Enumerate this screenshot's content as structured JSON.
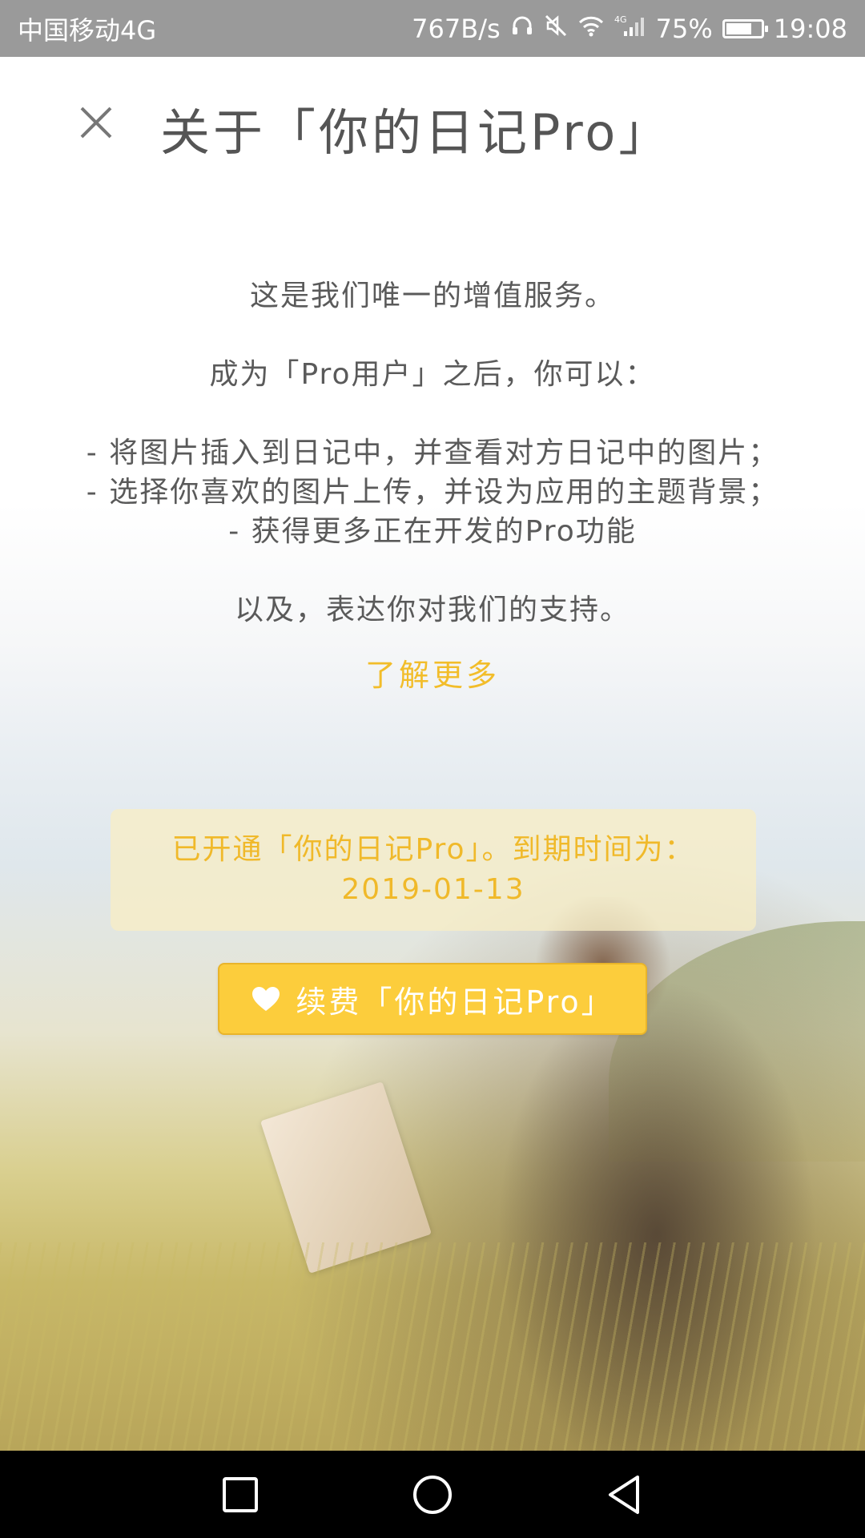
{
  "status_bar": {
    "carrier": "中国移动4G",
    "network_speed": "767B/s",
    "signal_type": "4G",
    "battery_percent": "75%",
    "battery_level": 0.75,
    "time": "19:08"
  },
  "header": {
    "title": "关于「你的日记Pro」",
    "close_icon": "close-icon"
  },
  "description": {
    "line1": "这是我们唯一的增值服务。",
    "line2": "成为「Pro用户」之后，你可以：",
    "features": [
      "- 将图片插入到日记中，并查看对方日记中的图片；",
      "- 选择你喜欢的图片上传，并设为应用的主题背景；",
      "- 获得更多正在开发的Pro功能"
    ],
    "line3": "以及，表达你对我们的支持。"
  },
  "learn_more": {
    "label": "了解更多"
  },
  "pro_status": {
    "text": "已开通「你的日记Pro」。到期时间为：",
    "expiry_date": "2019-01-13"
  },
  "renew_button": {
    "label": "续费「你的日记Pro」",
    "icon": "heart-icon"
  },
  "nav_bar": {
    "recent_icon": "square-icon",
    "home_icon": "circle-icon",
    "back_icon": "triangle-back-icon"
  },
  "colors": {
    "accent": "#f2bd2a",
    "button": "#fccd3c",
    "status_bar": "#9a9a9a",
    "text": "#5a5a5a"
  }
}
